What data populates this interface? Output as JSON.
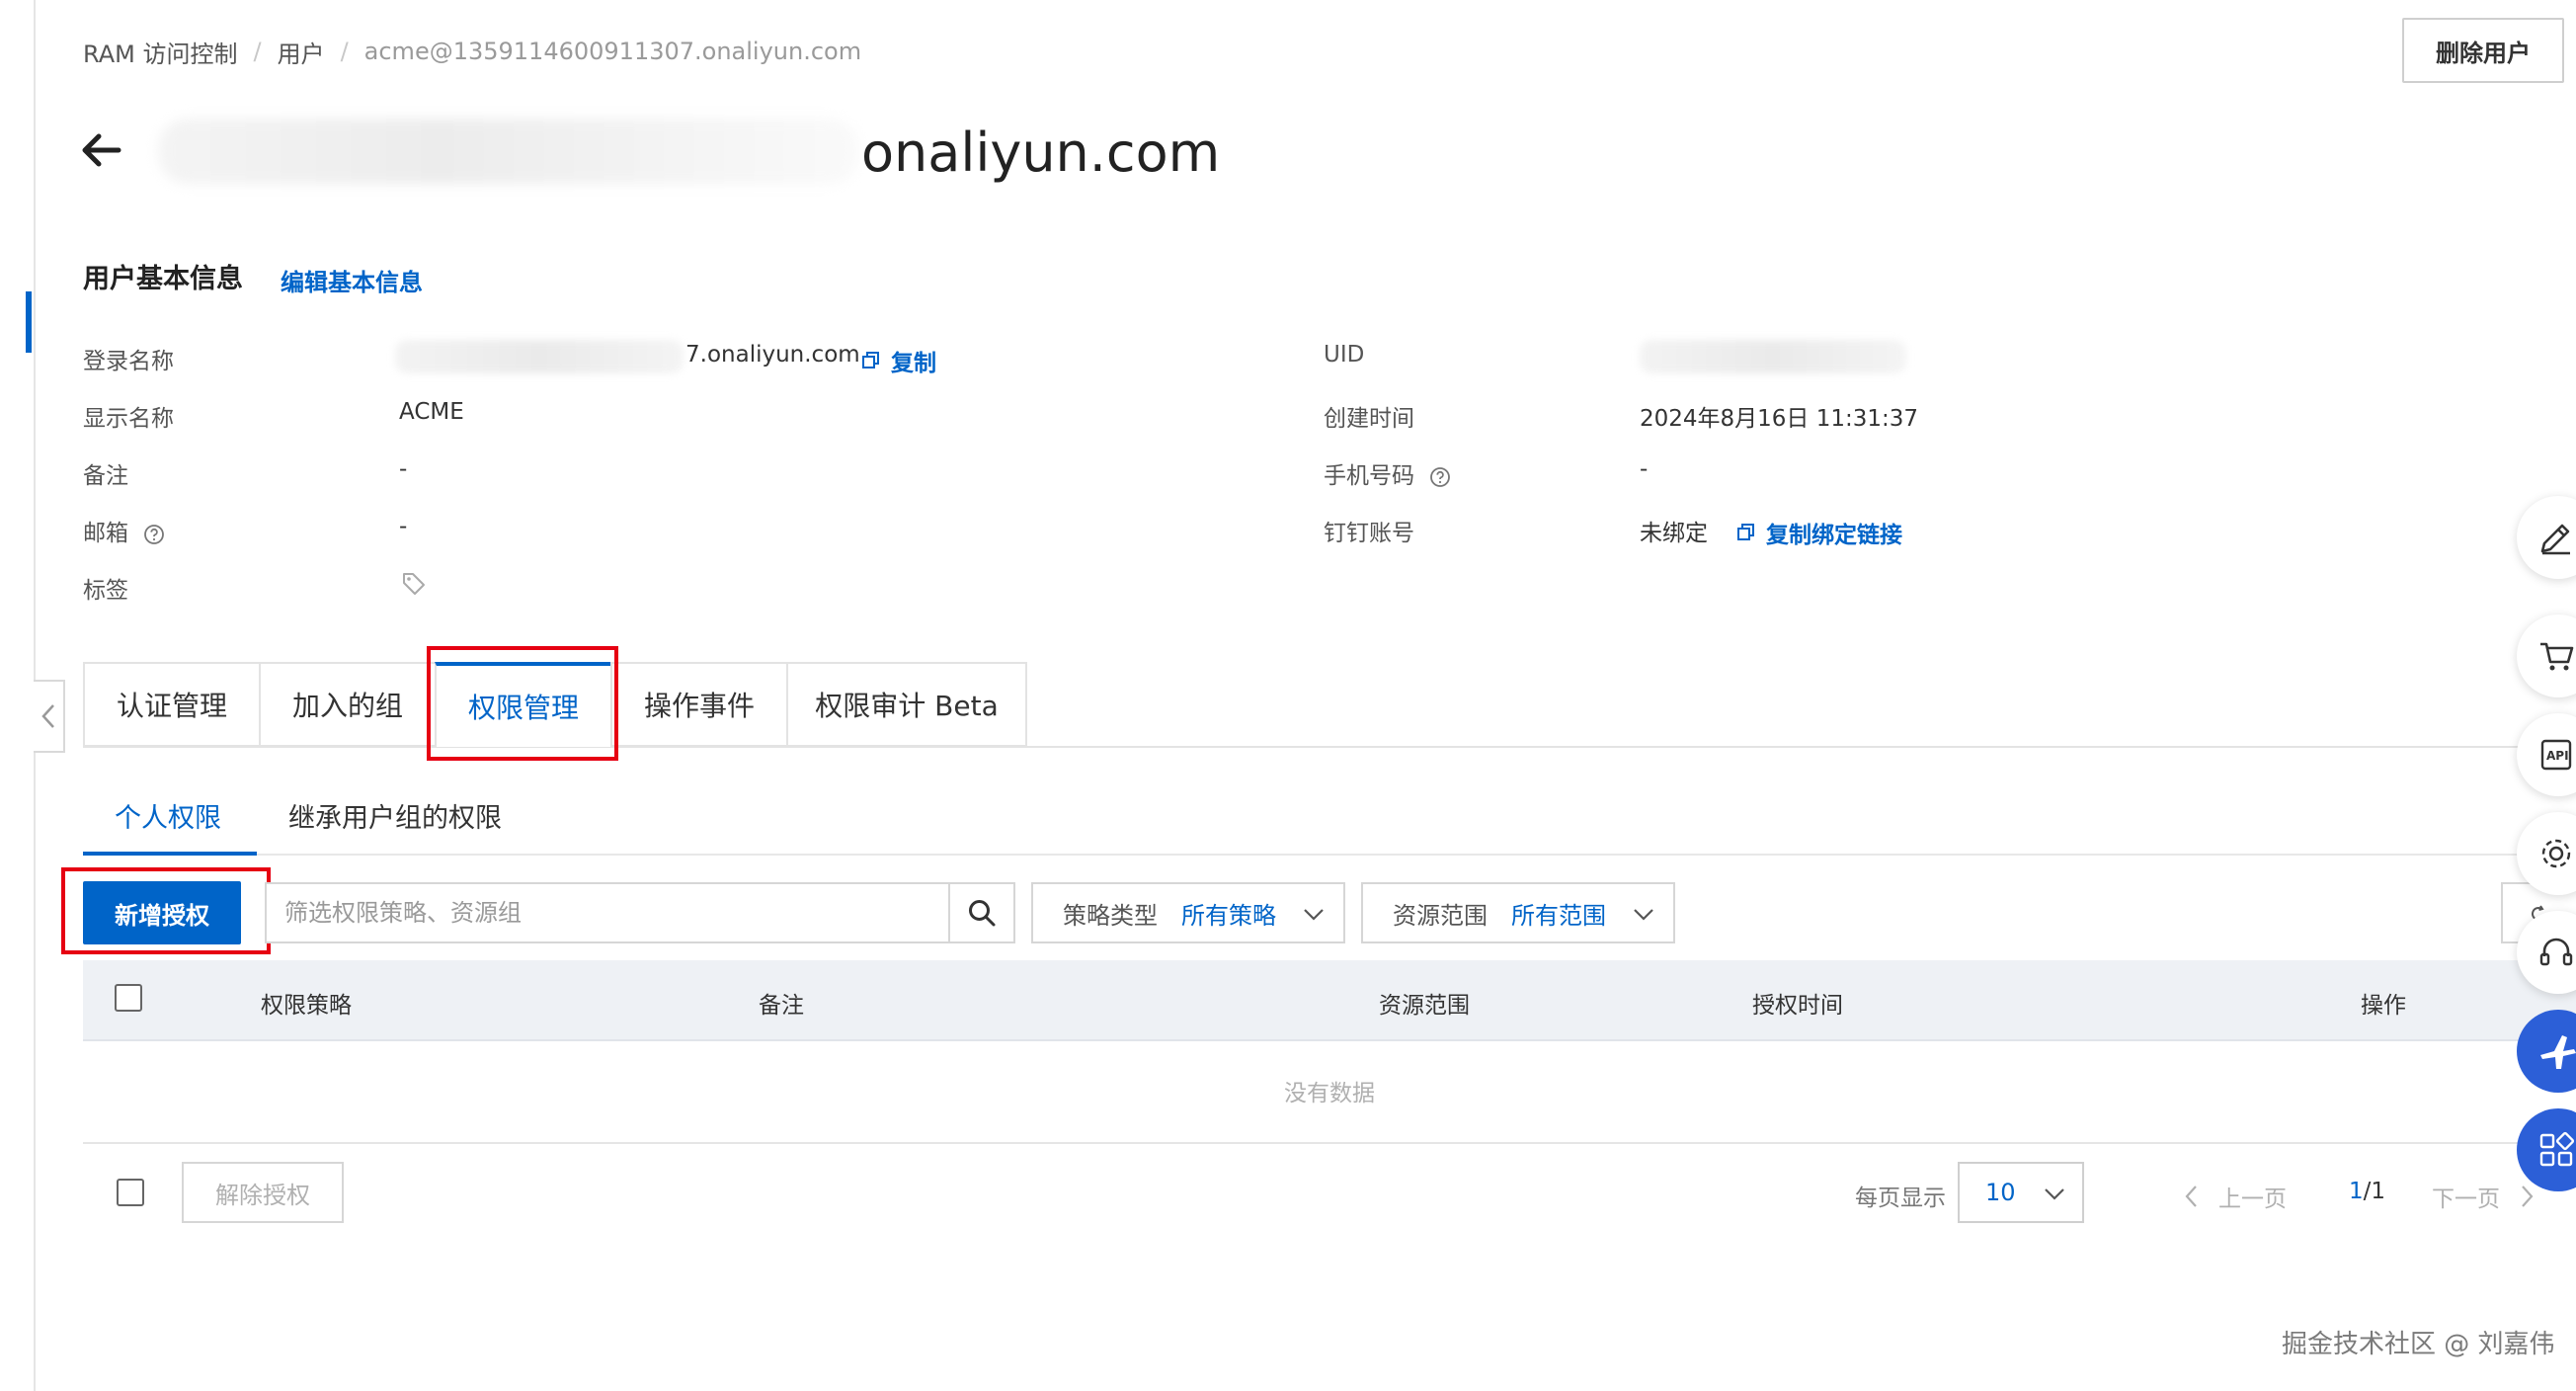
{
  "breadcrumb": {
    "root": "RAM 访问控制",
    "sep": "/",
    "users": "用户",
    "current": "acme@1359114600911307.onaliyun.com"
  },
  "header": {
    "delete_button": "删除用户",
    "title_visible_tail": "onaliyun.com"
  },
  "basic_info": {
    "section_title": "用户基本信息",
    "edit_link": "编辑基本信息",
    "login_name_label": "登录名称",
    "login_name_visible_tail": "7.onaliyun.com",
    "copy_link": "复制",
    "display_name_label": "显示名称",
    "display_name_value": "ACME",
    "remark_label": "备注",
    "remark_value": "-",
    "email_label": "邮箱",
    "email_value": "-",
    "tags_label": "标签",
    "uid_label": "UID",
    "created_label": "创建时间",
    "created_value": "2024年8月16日 11:31:37",
    "phone_label": "手机号码",
    "phone_value": "-",
    "dingtalk_label": "钉钉账号",
    "dingtalk_value": "未绑定",
    "copy_bind_link": "复制绑定链接"
  },
  "tabs": [
    {
      "label": "认证管理"
    },
    {
      "label": "加入的组"
    },
    {
      "label": "权限管理"
    },
    {
      "label": "操作事件"
    },
    {
      "label": "权限审计 Beta"
    }
  ],
  "active_tab": "权限管理",
  "subtabs": [
    {
      "label": "个人权限"
    },
    {
      "label": "继承用户组的权限"
    }
  ],
  "toolbar": {
    "add_grant_button": "新增授权",
    "search_placeholder": "筛选权限策略、资源组",
    "policy_type_label": "策略类型",
    "policy_type_value": "所有策略",
    "resource_scope_label": "资源范围",
    "resource_scope_value": "所有范围"
  },
  "table": {
    "columns": [
      "权限策略",
      "备注",
      "资源范围",
      "授权时间",
      "操作"
    ],
    "rows": [],
    "empty_text": "没有数据"
  },
  "footer": {
    "revoke_button": "解除授权",
    "page_size_label": "每页显示",
    "page_size_value": "10",
    "prev_label": "上一页",
    "page_current": "1",
    "page_total": "/1",
    "next_label": "下一页"
  },
  "watermark": "掘金技术社区 @ 刘嘉伟",
  "colors": {
    "accent": "#0064c8",
    "highlight_box": "#e60012",
    "table_header_bg": "#eef1f5"
  },
  "floating_tools": [
    "edit-icon",
    "cart-icon",
    "api-icon",
    "settings-icon",
    "support-icon",
    "plane-icon",
    "apps-icon"
  ]
}
